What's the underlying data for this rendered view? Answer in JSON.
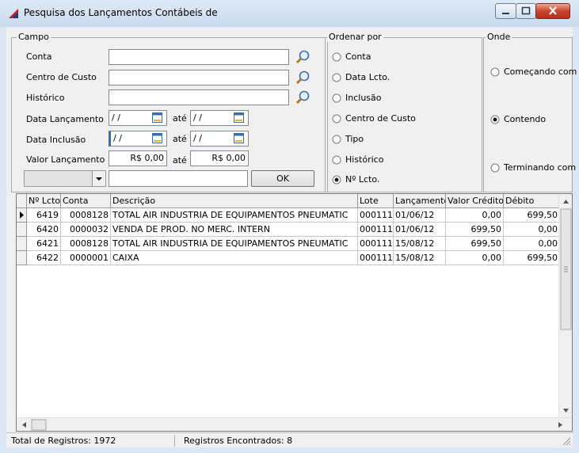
{
  "window": {
    "title": "Pesquisa dos Lançamentos Contábeis de"
  },
  "campo": {
    "group_label": "Campo",
    "conta_label": "Conta",
    "conta_value": "",
    "centro_label": "Centro de Custo",
    "centro_value": "",
    "historico_label": "Histórico",
    "historico_value": "",
    "data_lancamento_label": "Data Lançamento",
    "data_lancamento_de": " / /",
    "data_lancamento_ate": " / /",
    "data_inclusao_label": "Data Inclusão",
    "data_inclusao_de": " / /",
    "data_inclusao_ate": " / /",
    "valor_label": "Valor Lançamento",
    "valor_de": "R$ 0,00",
    "valor_ate": "R$ 0,00",
    "ate_label": "até",
    "combo_value": "",
    "filtro_value": "",
    "ok_label": "OK"
  },
  "ordenar": {
    "group_label": "Ordenar por",
    "options": [
      {
        "label": "Conta",
        "checked": false
      },
      {
        "label": "Data Lcto.",
        "checked": false
      },
      {
        "label": "Inclusão",
        "checked": false
      },
      {
        "label": "Centro de Custo",
        "checked": false
      },
      {
        "label": "Tipo",
        "checked": false
      },
      {
        "label": "Histórico",
        "checked": false
      },
      {
        "label": "Nº Lcto.",
        "checked": true
      }
    ]
  },
  "onde": {
    "group_label": "Onde",
    "options": [
      {
        "label": "Começando com",
        "checked": false
      },
      {
        "label": "Contendo",
        "checked": true
      },
      {
        "label": "Terminando com",
        "checked": false
      }
    ]
  },
  "grid": {
    "columns": [
      "Nº Lcto",
      "Conta",
      "Descrição",
      "Lote",
      "Lançamento",
      "Valor Crédito",
      "Débito",
      "("
    ],
    "rows": [
      [
        "6419",
        "0008128",
        "TOTAL AIR INDUSTRIA DE EQUIPAMENTOS PNEUMATIC",
        "000111",
        "01/06/12",
        "0,00",
        "699,50"
      ],
      [
        "6420",
        "0000032",
        "VENDA DE PROD. NO MERC. INTERN",
        "000111",
        "01/06/12",
        "699,50",
        "0,00"
      ],
      [
        "6421",
        "0008128",
        "TOTAL AIR INDUSTRIA DE EQUIPAMENTOS PNEUMATIC",
        "000111",
        "15/08/12",
        "699,50",
        "0,00"
      ],
      [
        "6422",
        "0000001",
        "CAIXA",
        "000111",
        "15/08/12",
        "0,00",
        "699,50"
      ]
    ]
  },
  "status": {
    "total": "Total de Registros: 1972",
    "encontrados": "Registros Encontrados: 8"
  }
}
